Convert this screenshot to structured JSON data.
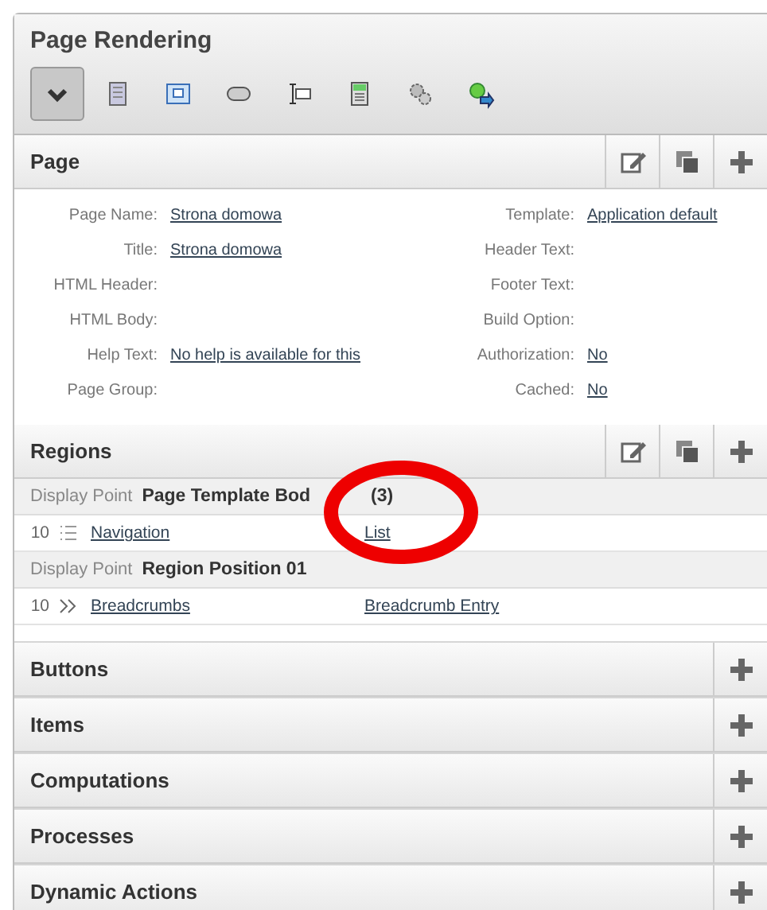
{
  "panel": {
    "title": "Page Rendering"
  },
  "toolbar": [
    {
      "selected": true
    },
    {
      "selected": false
    },
    {
      "selected": false
    },
    {
      "selected": false
    },
    {
      "selected": false
    },
    {
      "selected": false
    },
    {
      "selected": false
    },
    {
      "selected": false
    }
  ],
  "page_section": {
    "title": "Page",
    "expanded": true,
    "left": [
      {
        "label": "Page Name:",
        "value": "Strona domowa"
      },
      {
        "label": "Title:",
        "value": "Strona domowa"
      },
      {
        "label": "HTML Header:"
      },
      {
        "label": "HTML Body:"
      },
      {
        "label": "Help Text:",
        "value": "No help is available for this"
      },
      {
        "label": "Page Group:"
      }
    ],
    "right": [
      {
        "label": "Template:",
        "value": "Application default"
      },
      {
        "label": "Header Text:"
      },
      {
        "label": "Footer Text:"
      },
      {
        "label": "Build Option:"
      },
      {
        "label": "Authorization:",
        "value": "No"
      },
      {
        "label": "Cached:",
        "value": "No"
      }
    ]
  },
  "regions_section": {
    "title": "Regions",
    "expanded": true,
    "groups": [
      {
        "prefix": "Display Point",
        "name": "Page Template Bod",
        "suffix": "(3)",
        "regions": [
          {
            "kind": "list",
            "seq": "10",
            "name": "Navigation",
            "type": "List"
          }
        ]
      },
      {
        "prefix": "Display Point",
        "name": "Region Position 01",
        "regions": [
          {
            "kind": "breadcrumb",
            "seq": "10",
            "name": "Breadcrumbs",
            "type": "Breadcrumb Entry"
          }
        ]
      }
    ]
  },
  "collapsed_sections": [
    {
      "title": "Buttons",
      "expanded": false
    },
    {
      "title": "Items",
      "expanded": false
    },
    {
      "title": "Computations",
      "expanded": false
    },
    {
      "title": "Processes",
      "expanded": false
    },
    {
      "title": "Dynamic Actions",
      "expanded": false
    }
  ]
}
